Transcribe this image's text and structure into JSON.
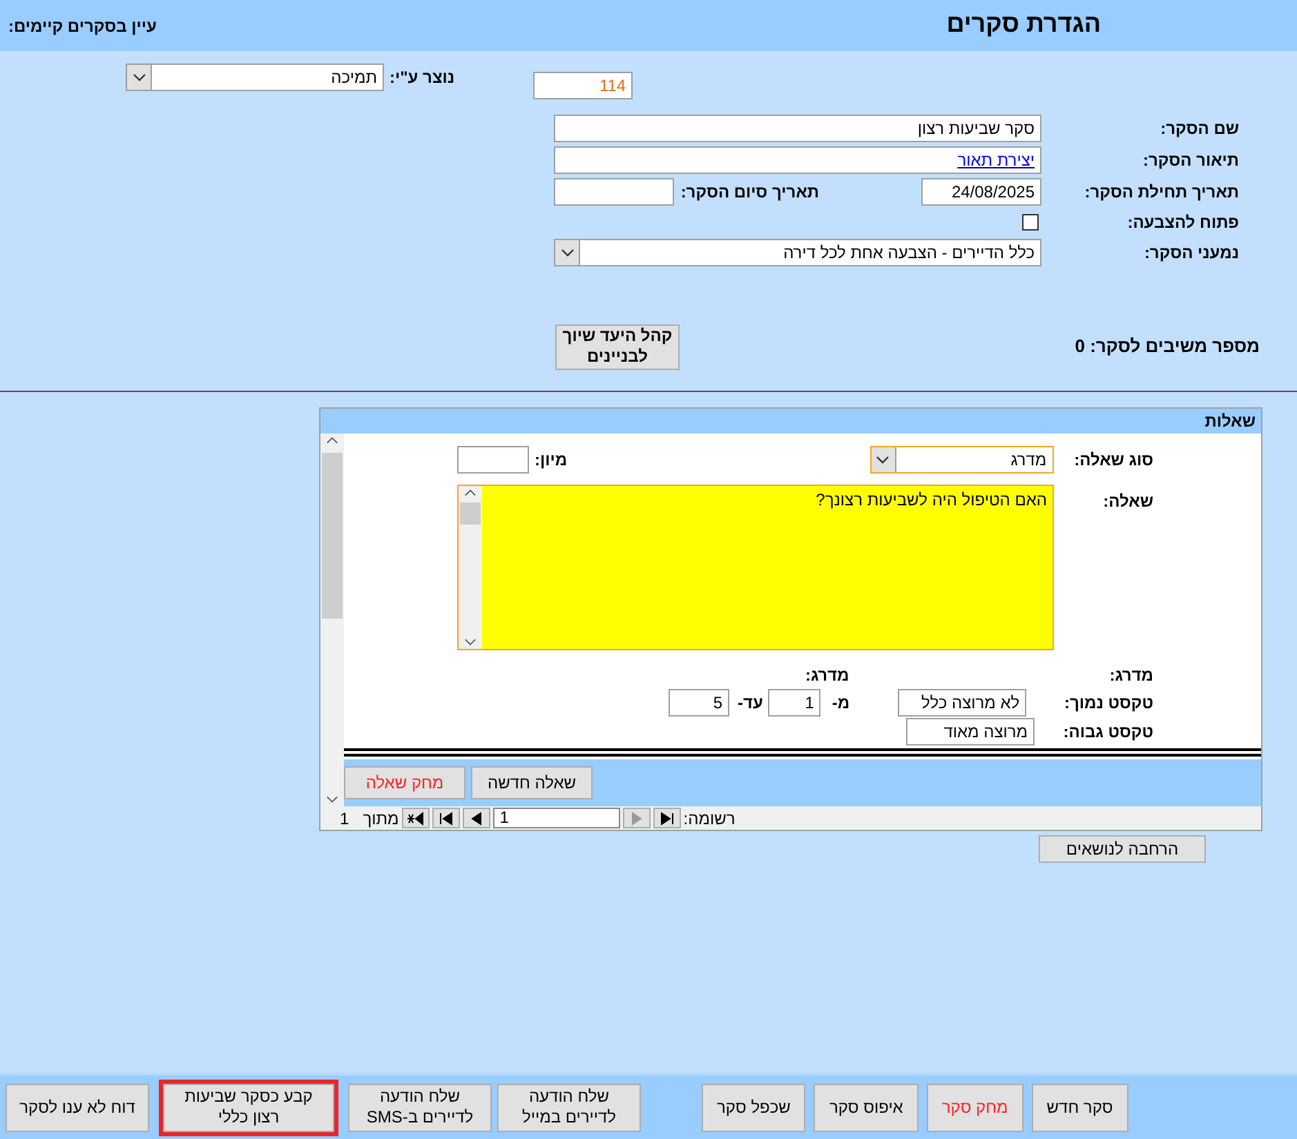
{
  "header": {
    "title": "הגדרת סקרים",
    "browse_label": "עיין בסקרים קיימים:"
  },
  "creator": {
    "label": "נוצר ע\"י:",
    "value": "תמיכה"
  },
  "survey_id": "114",
  "fields": {
    "name": {
      "label": "שם הסקר:",
      "value": "סקר שביעות רצון"
    },
    "description": {
      "label": "תיאור הסקר:",
      "link": "יצירת תאור"
    },
    "start_date": {
      "label": "תאריך תחילת הסקר:",
      "value": "24/08/2025"
    },
    "end_date": {
      "label": "תאריך סיום הסקר:"
    },
    "open_for_voting": {
      "label": "פתוח להצבעה:",
      "checked": false
    },
    "recipients": {
      "label": "נמעני הסקר:",
      "value": "כלל הדיירים - הצבעה אחת לכל דירה"
    }
  },
  "audience_button": "קהל היעד שיוך לבניינים",
  "respondents": "מספר משיבים לסקר: 0",
  "questions": {
    "title": "שאלות",
    "type": {
      "label": "סוג שאלה:",
      "value": "מדרג"
    },
    "sort": {
      "label": "מיון:"
    },
    "question": {
      "label": "שאלה:",
      "value": "האם הטיפול היה לשביעות רצונך?"
    },
    "scale_label": "מדרג:",
    "scale_label_2": "מדרג:",
    "low_text": {
      "label": "טקסט נמוך:",
      "value": "לא מרוצה כלל"
    },
    "high_text": {
      "label": "טקסט גבוה:",
      "value": "מרוצה מאוד"
    },
    "from": {
      "label": "מ-",
      "value": "1"
    },
    "to": {
      "label": "עד-",
      "value": "5"
    },
    "buttons": [
      {
        "label": "שאלה חדשה",
        "kind": "normal"
      },
      {
        "label": "מחק שאלה",
        "kind": "danger"
      }
    ],
    "nav": {
      "label": "רשומה:",
      "current": "1",
      "prev_enabled": false,
      "of_label": "מתוך",
      "total": "1"
    }
  },
  "expand_button": "הרחבה לנושאים",
  "survey_buttons": [
    {
      "label": "סקר חדש",
      "kind": "normal"
    },
    {
      "label": "מחק סקר",
      "kind": "danger"
    },
    {
      "label": "איפוס סקר",
      "kind": "normal"
    },
    {
      "label": "שכפל סקר",
      "kind": "normal"
    }
  ],
  "action_buttons": [
    {
      "label": "שלח הודעה לדיירים במייל",
      "highlighted": false
    },
    {
      "label": "שלח הודעה לדיירים ב-SMS",
      "highlighted": false
    },
    {
      "label": "קבע כסקר שביעות רצון כללי",
      "highlighted": true
    },
    {
      "label": "דוח לא ענו לסקר",
      "highlighted": false
    }
  ]
}
